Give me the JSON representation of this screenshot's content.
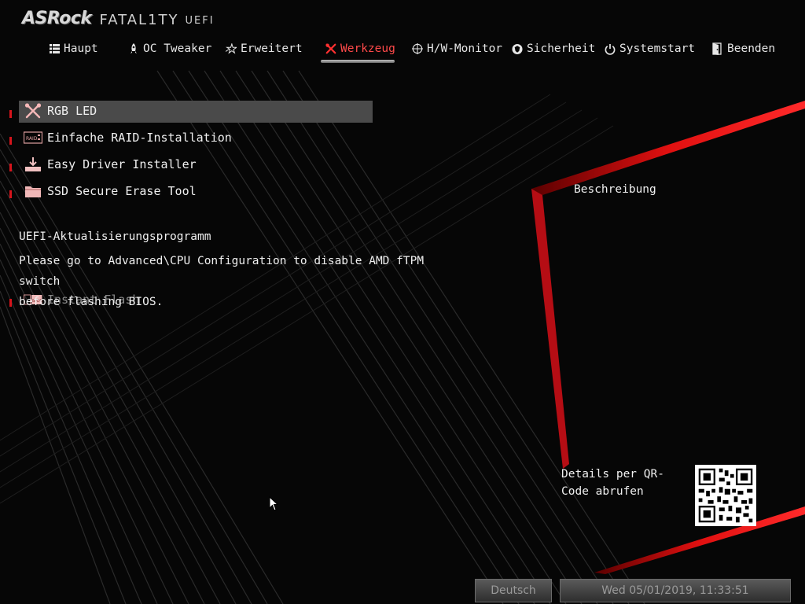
{
  "header": {
    "brand": "ASRock",
    "product": "FATAL1TY",
    "firmware": "UEFI"
  },
  "nav": {
    "items": [
      {
        "label": "Haupt",
        "icon": "list-icon"
      },
      {
        "label": "OC Tweaker",
        "icon": "rocket-icon"
      },
      {
        "label": "Erweitert",
        "icon": "star-icon"
      },
      {
        "label": "Werkzeug",
        "icon": "tools-icon",
        "active": true
      },
      {
        "label": "H/W-Monitor",
        "icon": "crosshair-icon"
      },
      {
        "label": "Sicherheit",
        "icon": "shield-icon"
      },
      {
        "label": "Systemstart",
        "icon": "power-icon"
      },
      {
        "label": "Beenden",
        "icon": "exit-door-icon"
      }
    ]
  },
  "menu": {
    "items": [
      {
        "label": "RGB LED",
        "icon": "wrench-screwdriver-icon",
        "selected": true
      },
      {
        "label": "Einfache RAID-Installation",
        "icon": "raid-icon"
      },
      {
        "label": "Easy Driver Installer",
        "icon": "download-drive-icon"
      },
      {
        "label": "SSD Secure Erase Tool",
        "icon": "folder-icon"
      }
    ]
  },
  "flash": {
    "section_title": "UEFI-Aktualisierungsprogramm",
    "warning_line1": "Please go to Advanced\\CPU Configuration to disable AMD fTPM switch",
    "warning_line2": "before flashing BIOS.",
    "item_label": "Instant Flash",
    "item_icon": "bios-chip-icon"
  },
  "description": {
    "title": "Beschreibung",
    "qr_text": "Details per QR-Code abrufen"
  },
  "footer": {
    "language": "Deutsch",
    "datetime": "Wed 05/01/2019, 11:33:51"
  },
  "colors": {
    "accent": "#d6141c",
    "active_nav": "#ff4a4a",
    "selection": "#4a4a4a"
  }
}
